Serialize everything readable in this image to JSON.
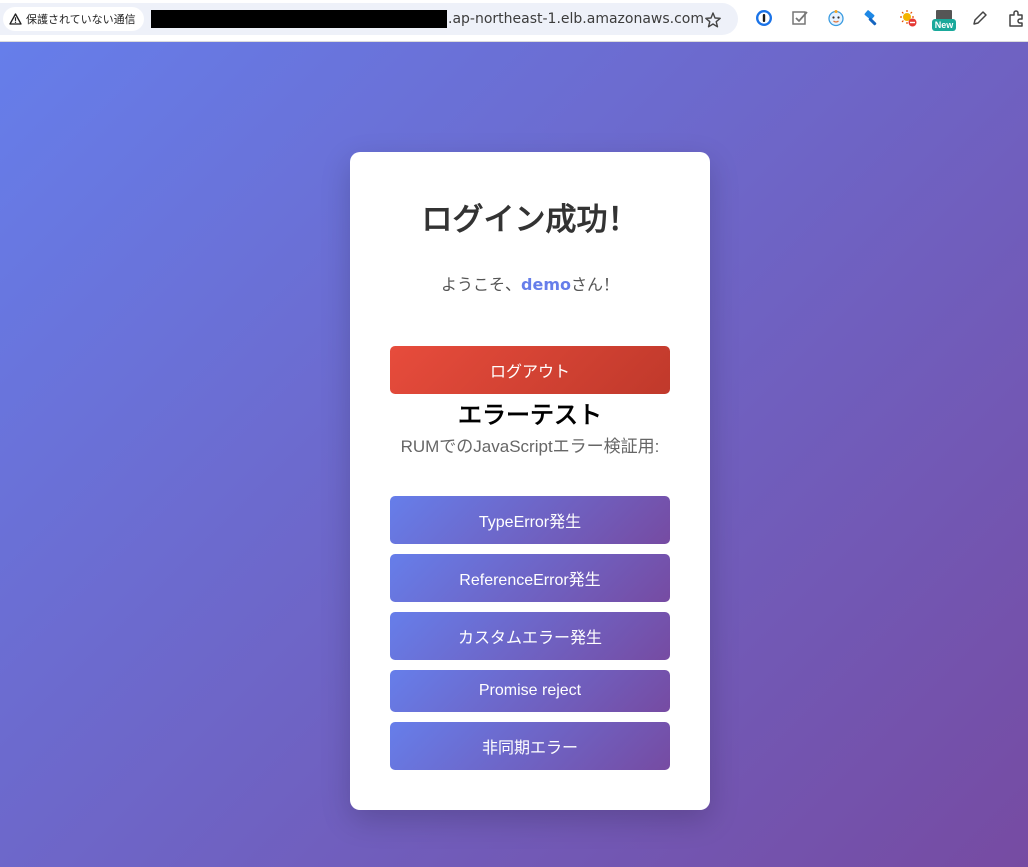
{
  "browser": {
    "security_label": "保護されていない通信",
    "url_visible": ".ap-northeast-1.elb.amazonaws.com",
    "extensions": [
      {
        "name": "1password-icon",
        "badge": ""
      },
      {
        "name": "checklist-icon",
        "badge": ""
      },
      {
        "name": "face-icon",
        "badge": ""
      },
      {
        "name": "hammer-icon",
        "badge": ""
      },
      {
        "name": "sun-blocked-icon",
        "badge": ""
      },
      {
        "name": "new-extension-icon",
        "badge": "New"
      },
      {
        "name": "pen-icon",
        "badge": ""
      },
      {
        "name": "puzzle-icon",
        "badge": ""
      }
    ]
  },
  "card": {
    "title": "ログイン成功！",
    "welcome_prefix": "ようこそ、",
    "username": "demo",
    "welcome_suffix": "さん！",
    "logout_label": "ログアウト",
    "error_section_title": "エラーテスト",
    "error_section_desc": "RUMでのJavaScriptエラー検証用:",
    "error_buttons": [
      {
        "label": "TypeError発生"
      },
      {
        "label": "ReferenceError発生"
      },
      {
        "label": "カスタムエラー発生"
      },
      {
        "label": "Promise reject"
      },
      {
        "label": "非同期エラー"
      }
    ]
  },
  "colors": {
    "page_gradient_start": "#667eea",
    "page_gradient_end": "#764ba2",
    "logout_start": "#e74c3c",
    "logout_end": "#c0392b",
    "username": "#667eea"
  }
}
